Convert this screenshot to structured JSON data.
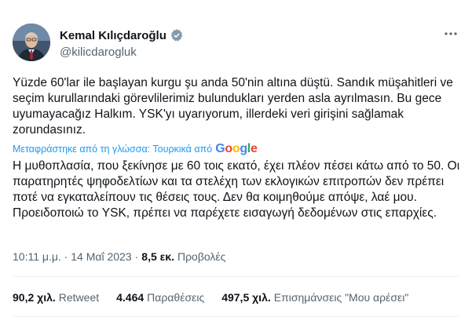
{
  "author": {
    "display_name": "Kemal Kılıçdaroğlu",
    "handle": "@kilicdarogluk",
    "avatar_icon": "profile-photo",
    "verified_icon": "verified-badge-icon"
  },
  "tweet": {
    "original_text": "Yüzde 60'lar ile başlayan kurgu şu anda 50'nin altına düştü. Sandık müşahitleri ve seçim kurullarındaki görevlilerimiz bulundukları yerden asla ayrılmasın. Bu gece uyumayacağız Halkım. YSK'yı uyarıyorum, illerdeki veri girişini sağlamak zorundasınız.",
    "translation_note": "Μεταφράστηκε από τη γλώσσα: Τουρκικά από",
    "translation_provider": "Google",
    "translated_text": "Η μυθοπλασία, που ξεκίνησε με 60 τοις εκατό, έχει πλέον πέσει κάτω από το 50. Οι παρατηρητές ψηφοδελτίων και τα στελέχη των εκλογικών επιτροπών δεν πρέπει ποτέ να εγκαταλείπουν τις θέσεις τους. Δεν θα κοιμηθούμε απόψε, λαέ μου. Προειδοποιώ το YSK, πρέπει να παρέχετε εισαγωγή δεδομένων στις επαρχίες."
  },
  "meta": {
    "timestamp": "10:11 μ.μ. · 14 Μαΐ 2023",
    "separator": "·",
    "views_count": "8,5 εκ.",
    "views_label": "Προβολές"
  },
  "stats": {
    "retweets_count": "90,2 χιλ.",
    "retweets_label": "Retweet",
    "quotes_count": "4.464",
    "quotes_label": "Παραθέσεις",
    "likes_count": "497,5 χιλ.",
    "likes_label": "Επισημάνσεις \"Μου αρέσει\""
  },
  "colors": {
    "accent": "#1d9bf0",
    "text": "#0f1419",
    "secondary": "#536471"
  }
}
